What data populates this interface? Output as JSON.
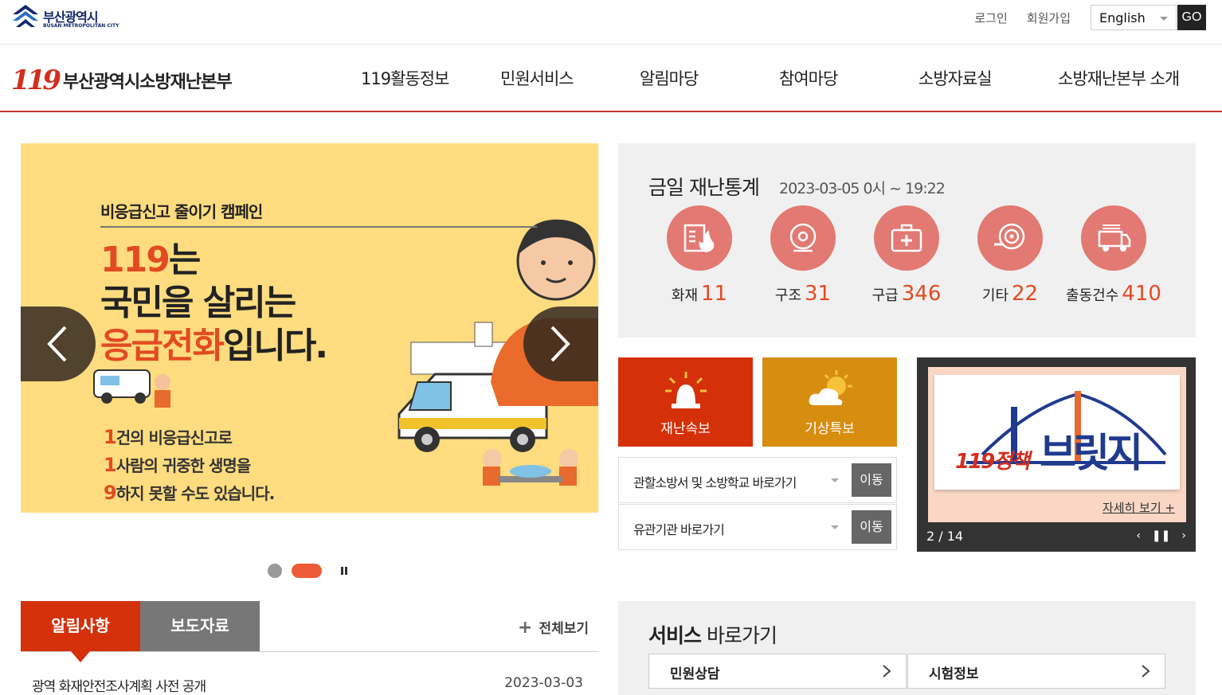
{
  "top": {
    "city_name": "부산광역시",
    "city_sub": "BUSAN METROPOLITAN CITY",
    "login": "로그인",
    "signup": "회원가입",
    "language": "English",
    "go": "GO"
  },
  "header": {
    "logo_num": "119",
    "org_name": "부산광역시소방재난본부",
    "nav": [
      "119활동정보",
      "민원서비스",
      "알림마당",
      "참여마당",
      "소방자료실",
      "소방재난본부 소개"
    ]
  },
  "banner": {
    "campaign": "비응급신고 줄이기 캠페인",
    "line1_red": "119",
    "line1_rest": "는",
    "line2": "국민을 살리는",
    "line3_red": "응급전화",
    "line3_rest": "입니다.",
    "sub": [
      {
        "n": "1",
        "text": "건의 비응급신고로"
      },
      {
        "n": "1",
        "text": "사람의 귀중한 생명을"
      },
      {
        "n": "9",
        "text": "하지 못할 수도 있습니다."
      }
    ],
    "slide_count": 2,
    "active_slide": 2
  },
  "stats": {
    "title": "금일 재난통계",
    "date": "2023-03-05 0시 ~ 19:22",
    "items": [
      {
        "label": "화재",
        "value": "11",
        "icon": "fire-icon"
      },
      {
        "label": "구조",
        "value": "31",
        "icon": "rescue-icon"
      },
      {
        "label": "구급",
        "value": "346",
        "icon": "first-aid-icon"
      },
      {
        "label": "기타",
        "value": "22",
        "icon": "hose-icon"
      },
      {
        "label": "출동건수",
        "value": "410",
        "icon": "fire-truck-icon"
      }
    ]
  },
  "tiles": {
    "disaster": "재난속보",
    "weather": "기상특보"
  },
  "goto": {
    "row1_label": "관할소방서 및 소방학교 바로가기",
    "row2_label": "유관기관 바로가기",
    "button": "이동"
  },
  "promo": {
    "title": "브릿지",
    "badge": "119정책",
    "more": "자세히 보기 +",
    "counter": "2 / 14"
  },
  "notice": {
    "tab_notice": "알림사항",
    "tab_press": "보도자료",
    "view_all": "전체보기",
    "rows": [
      {
        "title": "광역 화재안전조사계획 사전 공개",
        "date": "2023-03-03"
      }
    ]
  },
  "services": {
    "title_bold": "서비스",
    "title_rest": "바로가기",
    "items": [
      "민원상담",
      "시험정보"
    ]
  },
  "colors": {
    "accent": "#d4300a",
    "stat_circle": "#e27972",
    "weather": "#d78d10",
    "banner_bg": "#fedc7f"
  }
}
